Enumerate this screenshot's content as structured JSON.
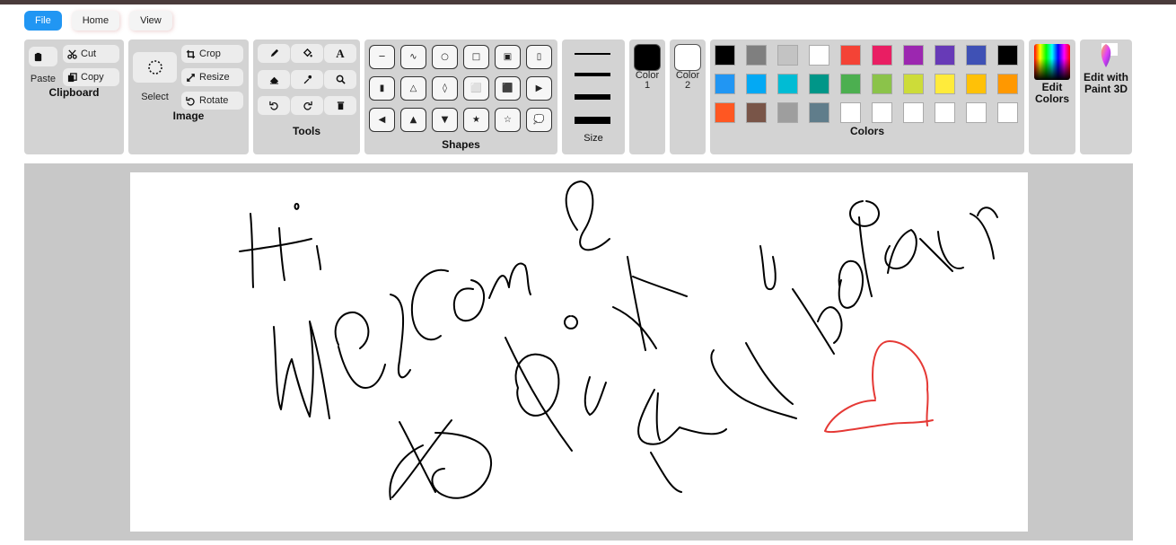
{
  "menu": {
    "file": "File",
    "home": "Home",
    "view": "View"
  },
  "clipboard": {
    "label": "Clipboard",
    "paste": "Paste",
    "cut": "Cut",
    "copy": "Copy"
  },
  "image": {
    "label": "Image",
    "select": "Select",
    "crop": "Crop",
    "resize": "Resize",
    "rotate": "Rotate"
  },
  "tools": {
    "label": "Tools",
    "text_glyph": "A"
  },
  "shapes": {
    "label": "Shapes",
    "items": [
      "─",
      "∿",
      "○",
      "□",
      "▣",
      "▯",
      "▮",
      "△",
      "◊",
      "⬜",
      "⬛",
      "▶",
      "◀",
      "▲",
      "▼",
      "★",
      "☆",
      "💭"
    ]
  },
  "size": {
    "label": "Size"
  },
  "color1": {
    "line1": "Color",
    "line2": "1",
    "value": "#000000"
  },
  "color2": {
    "line1": "Color",
    "line2": "2",
    "value": "#ffffff"
  },
  "colors": {
    "label": "Colors",
    "palette": [
      "#000000",
      "#7f7f7f",
      "#c3c3c3",
      "#ffffff",
      "#f44336",
      "#e91e63",
      "#9c27b0",
      "#673ab7",
      "#3f51b5",
      "#000000",
      "#2196f3",
      "#03a9f4",
      "#00bcd4",
      "#009688",
      "#4caf50",
      "#8bc34a",
      "#cddc39",
      "#ffeb3b",
      "#ffc107",
      "#ff9800",
      "#ff5722",
      "#795548",
      "#9e9e9e",
      "#607d8b",
      "#ffffff",
      "#ffffff",
      "#ffffff",
      "#ffffff",
      "#ffffff",
      "#ffffff"
    ]
  },
  "edit_colors": {
    "line1": "Edit",
    "line2": "Colors"
  },
  "paint3d": {
    "line1": "Edit with",
    "line2": "Paint 3D"
  },
  "canvas": {
    "ink_color": "#000000",
    "heart_color": "#e53935"
  }
}
